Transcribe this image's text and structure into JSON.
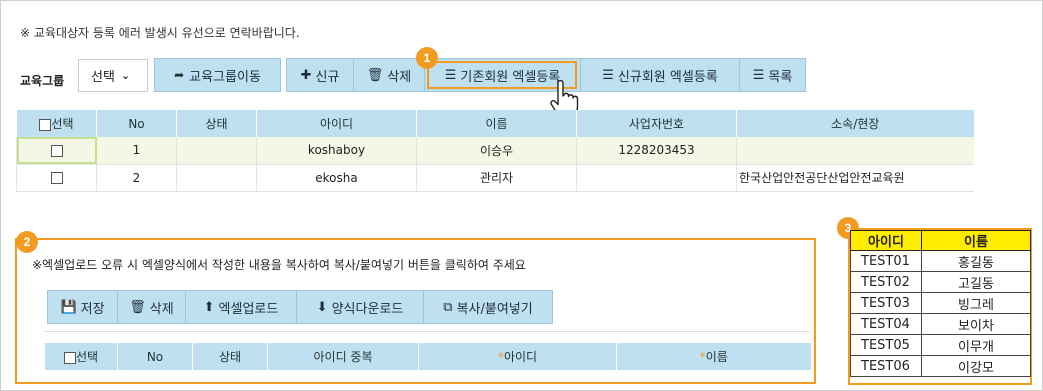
{
  "notice": "※ 교육대상자 등록 에러 발생시 유선으로 연락바랍니다.",
  "group_label": "교육그룹",
  "select_value": "선택",
  "move_button": "교육그룹이동",
  "toolbar": {
    "new": "신규",
    "delete": "삭제",
    "existing_excel": "기존회원 엑셀등록",
    "new_excel": "신규회원 엑셀등록",
    "list": "목록"
  },
  "badges": {
    "one": "1",
    "two": "2",
    "three": "3"
  },
  "grid1": {
    "headers": [
      "선택",
      "No",
      "상태",
      "아이디",
      "이름",
      "사업자번호",
      "소속/현장"
    ],
    "rows": [
      {
        "no": "1",
        "status": "",
        "id": "koshaboy",
        "name": "이승우",
        "biz": "1228203453",
        "org": ""
      },
      {
        "no": "2",
        "status": "",
        "id": "ekosha",
        "name": "관리자",
        "biz": "",
        "org": "한국산업안전공단산업안전교육원"
      }
    ]
  },
  "panel2": {
    "notice": "※엑셀업로드 오류 시 엑셀양식에서 작성한 내용을 복사하여 복사/붙여넣기 버튼을 클릭하여 주세요",
    "buttons": {
      "save": "저장",
      "delete": "삭제",
      "upload": "엑셀업로드",
      "download": "양식다운로드",
      "paste": "복사/붙여넣기"
    },
    "headers": {
      "select": "선택",
      "no": "No",
      "status": "상태",
      "dup": "아이디 중복",
      "id": "아이디",
      "name": "이름"
    },
    "required_mark": "*"
  },
  "sample": {
    "headers": [
      "아이디",
      "이름"
    ],
    "rows": [
      {
        "id": "TEST01",
        "name": "홍길동"
      },
      {
        "id": "TEST02",
        "name": "고길동"
      },
      {
        "id": "TEST03",
        "name": "빙그레"
      },
      {
        "id": "TEST04",
        "name": "보이차"
      },
      {
        "id": "TEST05",
        "name": "이무개"
      },
      {
        "id": "TEST06",
        "name": "이강모"
      }
    ]
  },
  "colors": {
    "accent_orange": "#f29b20",
    "button_blue": "#bfe0f0",
    "header_yellow": "#ffec00"
  }
}
